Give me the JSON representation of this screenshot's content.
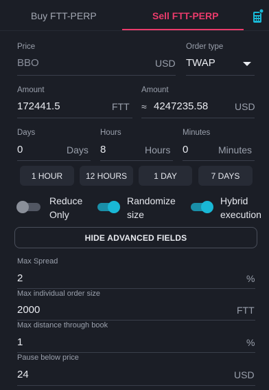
{
  "tabs": {
    "buy": "Buy FTT-PERP",
    "sell": "Sell FTT-PERP"
  },
  "price": {
    "label": "Price",
    "value": "BBO",
    "unit": "USD"
  },
  "order_type": {
    "label": "Order type",
    "value": "TWAP"
  },
  "amount_base": {
    "label": "Amount",
    "value": "172441.5",
    "unit": "FTT"
  },
  "amount_quote": {
    "label": "Amount",
    "approx": "≈",
    "value": "4247235.58",
    "unit": "USD"
  },
  "duration": {
    "days": {
      "label": "Days",
      "value": "0",
      "unit": "Days"
    },
    "hours": {
      "label": "Hours",
      "value": "8",
      "unit": "Hours"
    },
    "minutes": {
      "label": "Minutes",
      "value": "0",
      "unit": "Minutes"
    }
  },
  "presets": [
    "1 HOUR",
    "12 HOURS",
    "1 DAY",
    "7 DAYS"
  ],
  "toggles": {
    "reduce_only": {
      "line1": "Reduce",
      "line2": "Only",
      "on": false
    },
    "randomize_size": {
      "line1": "Randomize",
      "line2": "size",
      "on": true
    },
    "hybrid_execution": {
      "line1": "Hybrid",
      "line2": "execution",
      "on": true
    }
  },
  "advanced_button": "HIDE ADVANCED FIELDS",
  "advanced": {
    "max_spread": {
      "label": "Max Spread",
      "value": "2",
      "unit": "%"
    },
    "max_order_size": {
      "label": "Max individual order size",
      "value": "2000",
      "unit": "FTT"
    },
    "max_distance": {
      "label": "Max distance through book",
      "value": "1",
      "unit": "%"
    },
    "pause_below": {
      "label": "Pause below price",
      "value": "24",
      "unit": "USD"
    }
  },
  "colors": {
    "background": "#1b1e26",
    "sell_accent": "#ea3b6b",
    "toggle_on": "#19b8d6",
    "badge": "#19b8d6"
  },
  "icons": {
    "calculator": "calculator-icon",
    "dropdown": "chevron-down-icon"
  }
}
